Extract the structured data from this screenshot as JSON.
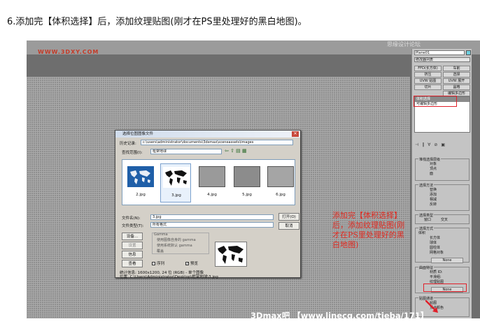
{
  "caption": "6.添加完【体积选择】后，添加纹理贴图(刚才在PS里处理好的黑白地图)。",
  "watermarks": {
    "left": "WWW.3DXY.COM",
    "right": "思缘设计论坛"
  },
  "panel": {
    "object_name": "Plane01",
    "modifier_list": "修改器列表",
    "buttons": [
      "FFD(长方体)",
      "车削",
      "挤压",
      "选择",
      "UVW 贴图",
      "UVW 展开",
      "切片",
      "晶格",
      "编辑多边形"
    ],
    "stack": [
      "体积选择",
      "可编辑多边形"
    ],
    "groups": {
      "stack_selection": {
        "title": "堆栈选择层级",
        "options": [
          "对象",
          "顶点",
          "面"
        ]
      },
      "select_by": {
        "title": "选择方法",
        "options": [
          "替换",
          "添加",
          "相减",
          "反转"
        ]
      },
      "select_type": {
        "title": "选择类型",
        "options": [
          "窗口",
          "交叉"
        ]
      },
      "alignment": {
        "title": "选择方式",
        "subtitle": "体积",
        "options": [
          "长方体",
          "球体",
          "圆柱体",
          "网格对象"
        ],
        "none": "None"
      },
      "surface": {
        "title": "曲面特征",
        "options": [
          "材质 ID:",
          "平滑组:",
          "纹理贴图"
        ],
        "none": "None"
      },
      "mapping": {
        "title": "贴图通道",
        "options": [
          "贴图",
          "顶点颜色"
        ]
      }
    }
  },
  "dialog": {
    "title": "选择位图图像文件",
    "history_label": "历史记录:",
    "history_value": "c:\\users\\administrator\\documents\\3dsmax\\sceneassets\\images",
    "lookin_label": "查找范围(I):",
    "lookin_value": "框架地球",
    "thumbnails": [
      "2.jpg",
      "3.jpg",
      "4.jpg",
      "5.jpg",
      "6.jpg"
    ],
    "filename_label": "文件名(N):",
    "filename_value": "3.jpg",
    "filetype_label": "文件类型(T):",
    "filetype_value": "所有格式",
    "open": "打开(O)",
    "cancel": "取消",
    "setup": "设备...",
    "settings": "设置",
    "info": "信息",
    "view": "查看",
    "gamma_title": "Gamma",
    "gamma_opts": [
      "使用图像自身的 gamma",
      "使用系统默认 gamma",
      "覆盖"
    ],
    "sequence": "序列",
    "preview": "预览",
    "stats": "统计信息: 1600x1200, 24 位 (RGB) - 单个图像",
    "location": "位置: C:\\Users\\Administrator\\Desktop\\框架地球\\3.jpg"
  },
  "annotation": "添加完【体积选择】后，添加纹理贴图(刚才在PS里处理好的黑白地图)",
  "footer": "3Dmax吧 【www.linecg.com/tieba/171】",
  "colors": {
    "annotation": "#e02a20",
    "highlight": "#e0202a"
  }
}
